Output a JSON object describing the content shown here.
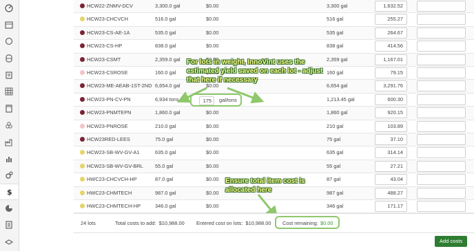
{
  "sidebar": {
    "icons": [
      "dashboard-icon",
      "calendar-icon",
      "circle-icon",
      "barrel-icon",
      "clipboard-icon",
      "grid-icon",
      "tank-icon",
      "cellar-icon",
      "factory-icon",
      "chart-icon",
      "cogs-icon",
      "dollar-icon",
      "pie-chart-icon",
      "document-icon",
      "layers-icon"
    ]
  },
  "rows": [
    {
      "color": "#7a2437",
      "name": "HCW22-ZNMV-DCV",
      "qty": "3,300.0 gal",
      "cost": "$0.00",
      "vol": "3,300 gal",
      "input_a": "1,632.52",
      "input_b": ""
    },
    {
      "color": "#e6d46a",
      "name": "HCW23-CHCVCH",
      "qty": "516.0 gal",
      "cost": "$0.00",
      "vol": "516 gal",
      "input_a": "255.27",
      "input_b": ""
    },
    {
      "color": "#7a2437",
      "name": "HCW23-CS-AE-1A",
      "qty": "535.0 gal",
      "cost": "$0.00",
      "vol": "535 gal",
      "input_a": "264.67",
      "input_b": ""
    },
    {
      "color": "#7a2437",
      "name": "HCW23-CS-HP",
      "qty": "838.0 gal",
      "cost": "$0.00",
      "vol": "838 gal",
      "input_a": "414.56",
      "input_b": ""
    },
    {
      "color": "#7a2437",
      "name": "HCW23-CSMT",
      "qty": "2,359.0 gal",
      "cost": "$0.00",
      "vol": "2,359 gal",
      "input_a": "1,167.01",
      "input_b": ""
    },
    {
      "color": "#f2c4c8",
      "name": "HCW23-CSROSE",
      "qty": "160.0 gal",
      "cost": "$0.00",
      "vol": "160 gal",
      "input_a": "79.15",
      "input_b": ""
    },
    {
      "color": "#7a2437",
      "name": "HCW23-ME-AEAB-1ST-2ND",
      "qty": "6,654.0 gal",
      "cost": "$0.00",
      "vol": "6,654 gal",
      "input_a": "3,291.76",
      "input_b": ""
    },
    {
      "color": "#7a2437",
      "name": "HCW23-PN-CV-PN",
      "qty": "6,934 tons",
      "cost": "$0.00",
      "vol": "1,213.45 gal",
      "input_a": "600.30",
      "input_b": ""
    },
    {
      "color": "#7a2437",
      "name": "HCW23-PNMTEPN",
      "qty": "1,860.0 gal",
      "cost": "$0.00",
      "vol": "1,860 gal",
      "input_a": "920.15",
      "input_b": ""
    },
    {
      "color": "#f2c4c8",
      "name": "HCW23-PNROSE",
      "qty": "210.0 gal",
      "cost": "$0.00",
      "vol": "210 gal",
      "input_a": "103.89",
      "input_b": ""
    },
    {
      "color": "#7a2437",
      "name": "HCW23RED-LEES",
      "qty": "75.0 gal",
      "cost": "$0.00",
      "vol": "75 gal",
      "input_a": "37.10",
      "input_b": ""
    },
    {
      "color": "#e6d46a",
      "name": "HCW23-SB-WV-GV-A1",
      "qty": "635.0 gal",
      "cost": "$0.00",
      "vol": "635 gal",
      "input_a": "314.14",
      "input_b": ""
    },
    {
      "color": "#e6d46a",
      "name": "HCW23-SB-WV-GV-BRL",
      "qty": "55.0 gal",
      "cost": "$0.00",
      "vol": "55 gal",
      "input_a": "27.21",
      "input_b": ""
    },
    {
      "color": "#e6d46a",
      "name": "HWC23-CHCVCH-HP",
      "qty": "87.0 gal",
      "cost": "$0.00",
      "vol": "87 gal",
      "input_a": "43.04",
      "input_b": ""
    },
    {
      "color": "#e6d46a",
      "name": "HWC23-CHMTECH",
      "qty": "987.0 gal",
      "cost": "$0.00",
      "vol": "987 gal",
      "input_a": "488.27",
      "input_b": ""
    },
    {
      "color": "#e6d46a",
      "name": "HWC23-CHMTECH-HP",
      "qty": "346.0 gal",
      "cost": "$0.00",
      "vol": "346 gal",
      "input_a": "171.17",
      "input_b": ""
    }
  ],
  "yield": {
    "value": "175",
    "unit": "gal/tons"
  },
  "callouts": {
    "weight": "For lots in weight, InnoVint uses the estimated yield saved on each lot - adjust that here if necessary",
    "total": "Ensure total item cost is allocated here"
  },
  "footer": {
    "lots": "24 lots",
    "total_label": "Total costs to add:",
    "total_value": "$10,988.00",
    "entered_label": "Entered cost on lots:",
    "entered_value": "$10,988.00",
    "remaining_label": "Cost remaining:",
    "remaining_value": "$0.00"
  },
  "actions": {
    "add_costs": "Add costs"
  },
  "colors": {
    "accent": "#2e7d32",
    "highlight_border": "#8ec86b",
    "callout_text": "#fcfa8a"
  }
}
